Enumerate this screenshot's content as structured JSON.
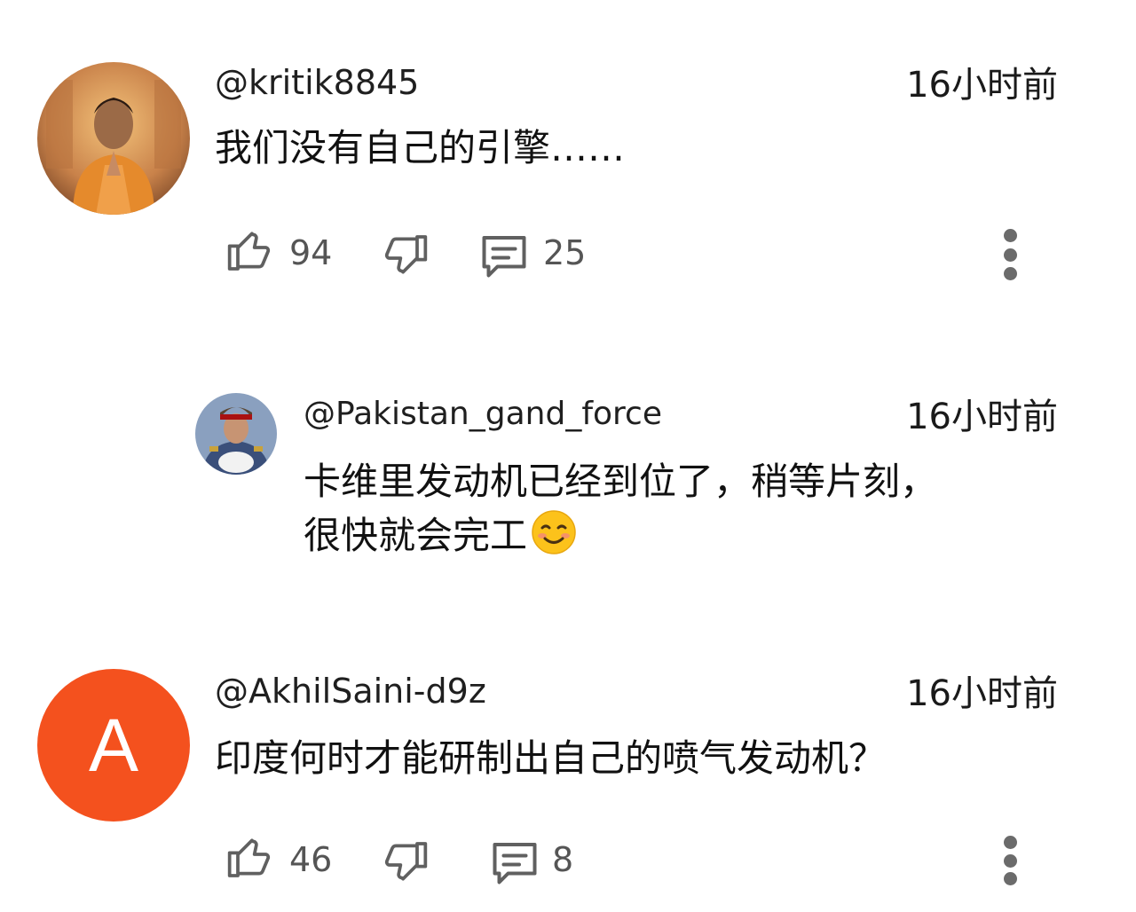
{
  "comments": [
    {
      "handle": "@kritik8845",
      "time": "16小时前",
      "text": "我们没有自己的引擎……",
      "likes": "94",
      "replies": "25",
      "avatar_icon": "person-praying-avatar"
    },
    {
      "handle": "@Pakistan_gand_force",
      "time": "16小时前",
      "text_line1": "卡维里发动机已经到位了，稍等片刻，",
      "text_line2": "很快就会完工",
      "emoji": "smiling-face-emoji",
      "avatar_icon": "officer-avatar"
    },
    {
      "handle": "@AkhilSaini-d9z",
      "time": "16小时前",
      "text": "印度何时才能研制出自己的喷气发动机？",
      "likes": "46",
      "replies": "8",
      "avatar_letter": "A",
      "avatar_color": "#f4511e"
    }
  ],
  "colors": {
    "avatar_orange": "#f4511e",
    "icon_gray": "#606060"
  }
}
